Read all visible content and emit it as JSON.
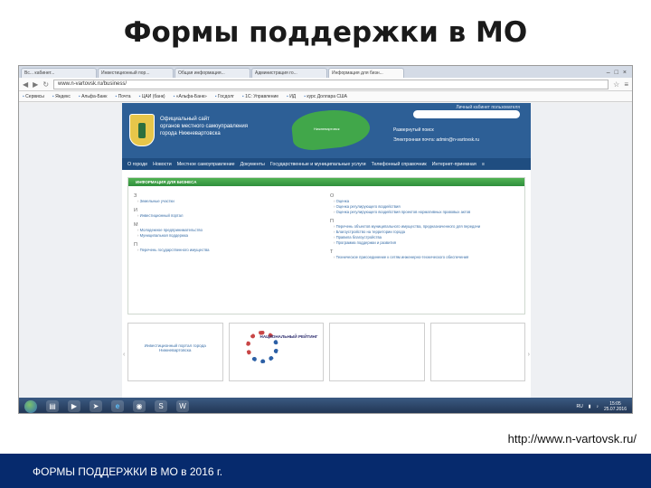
{
  "slide": {
    "title": "Формы поддержки в МО",
    "source_url": "http://www.n-vartovsk.ru/",
    "footer": "ФОРМЫ ПОДДЕРЖКИ В МО в 2016 г."
  },
  "browser": {
    "tabs": [
      {
        "label": "Вс... кабинет..."
      },
      {
        "label": "Инвестиционный пор..."
      },
      {
        "label": "Общая информация..."
      },
      {
        "label": "Администрация го..."
      },
      {
        "label": "Информация для бизн..."
      }
    ],
    "window_controls": [
      "–",
      "□",
      "×"
    ],
    "url": "www.n-vartovsk.ru/business/",
    "bookmarks": [
      "Сервисы",
      "Яндекс",
      "Альфа-Банк",
      "Почта",
      "ЦАИ (банк)",
      "«Альфа-Банк»",
      "Госдолг",
      "1С: Управление",
      "ИД",
      "курс Доллара США"
    ]
  },
  "site": {
    "login_link": "Личный кабинет пользователя",
    "org_name": [
      "Официальный сайт",
      "органов местного самоуправления",
      "города Нижневартовска"
    ],
    "map_label": "Нижневартовск",
    "header_links": [
      "Развернутый поиск",
      "Электронная почта: admin@n-vartovsk.ru"
    ],
    "nav": [
      "О городе",
      "Новости",
      "Местное самоуправление",
      "Документы",
      "Государственные и муниципальные услуги",
      "Телефонный справочник",
      "Интернет-приемная",
      "≡"
    ],
    "section_title": "ИНФОРМАЦИЯ ДЛЯ БИЗНЕСА",
    "col_left": [
      {
        "letter": "З",
        "items": [
          "Земельные участки"
        ]
      },
      {
        "letter": "И",
        "items": [
          "Инвестиционный портал"
        ]
      },
      {
        "letter": "М",
        "items": [
          "Молодежное предпринимательство",
          "Муниципальная поддержка"
        ]
      },
      {
        "letter": "П",
        "items": [
          "Перечень государственного имущества"
        ]
      }
    ],
    "col_right": [
      {
        "letter": "О",
        "items": [
          "Оценка",
          "Оценка регулирующего воздействия",
          "Оценка регулирующего воздействия проектов нормативных правовых актов"
        ]
      },
      {
        "letter": "П",
        "items": [
          "Перечень объектов муниципального имущества, предназначенного для передачи",
          "Благоустройство на территории города",
          "Правила благоустройства",
          "Программа поддержки и развития"
        ]
      },
      {
        "letter": "Т",
        "items": [
          "Техническое присоединение к сетям инженерно-технического обеспечения"
        ]
      }
    ],
    "banners": [
      "Инвестиционный портал города Нижневартовска",
      "НАЦИОНАЛЬНЫЙ РЕЙТИНГ",
      "",
      ""
    ]
  },
  "taskbar": {
    "icons": [
      "explorer-icon",
      "media-icon",
      "rocket-icon",
      "ie-icon",
      "chrome-icon",
      "skype-icon",
      "word-icon"
    ],
    "lang": "RU",
    "time": "15:05",
    "date": "25.07.2016"
  }
}
